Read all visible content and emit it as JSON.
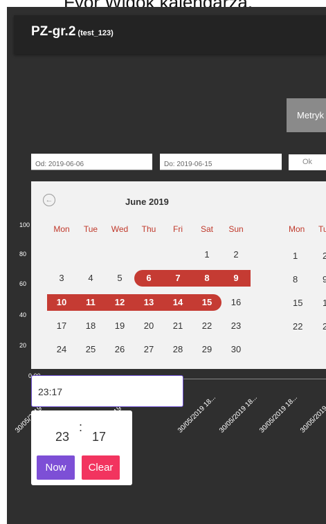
{
  "caption": "Fyor Widok kalendarza.",
  "header": {
    "title": "PZ-gr.2",
    "subtitle": "(test_123)"
  },
  "metric_button": "Metryk",
  "filters": {
    "from": "Od: 2019-06-06",
    "to": "Do: 2019-06-15",
    "ok": "Ok"
  },
  "y_ticks": [
    "100",
    "80",
    "60",
    "40",
    "20",
    "0.00"
  ],
  "calendar": {
    "month": "June 2019",
    "weekdays": [
      "Mon",
      "Tue",
      "Wed",
      "Thu",
      "Fri",
      "Sat",
      "Sun"
    ],
    "weeks": [
      [
        "",
        "",
        "",
        "",
        "",
        "1",
        "2"
      ],
      [
        "3",
        "4",
        "5",
        "6",
        "7",
        "8",
        "9"
      ],
      [
        "10",
        "11",
        "12",
        "13",
        "14",
        "15",
        "16"
      ],
      [
        "17",
        "18",
        "19",
        "20",
        "21",
        "22",
        "23"
      ],
      [
        "24",
        "25",
        "26",
        "27",
        "28",
        "29",
        "30"
      ]
    ],
    "selected": [
      "6",
      "7",
      "8",
      "9",
      "10",
      "11",
      "12",
      "13",
      "14",
      "15"
    ],
    "accent": "#c53b33",
    "next_month_weekdays": [
      "Mon",
      "Tu"
    ],
    "next_month_days": [
      [
        "1",
        "2"
      ],
      [
        "8",
        "9"
      ],
      [
        "15",
        "1"
      ],
      [
        "22",
        "2"
      ]
    ]
  },
  "x_labels": [
    "30/05/2019 18...",
    "30/05/2019 18...",
    "30/05/2019 18...",
    "30/05/2019 18...",
    "30/05/2019 18...",
    "30/05/2019 18..."
  ],
  "time_picker": {
    "value": "23:17",
    "hour": "23",
    "separator": ":",
    "minute": "17",
    "now": "Now",
    "clear": "Clear"
  },
  "colors": {
    "now": "#7d4fd6",
    "clear": "#f2345f",
    "metric": "#8a8a8a"
  }
}
